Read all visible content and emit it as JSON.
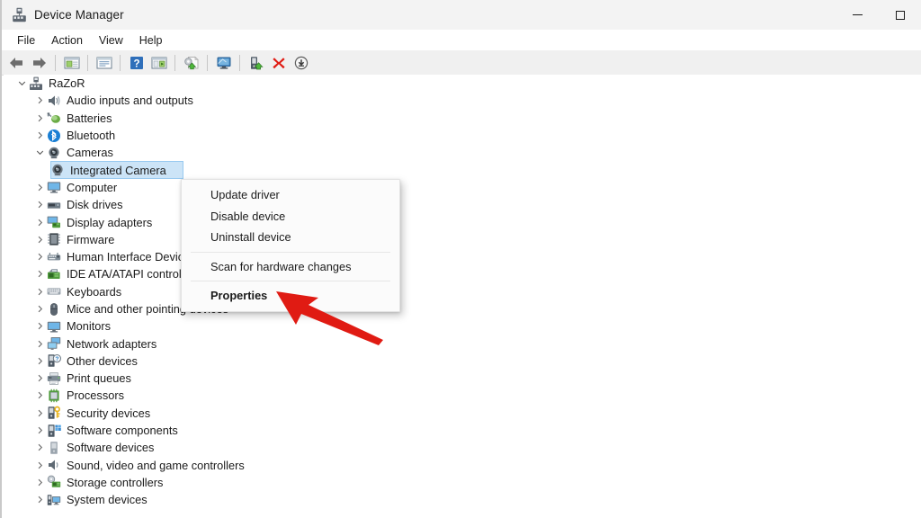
{
  "window": {
    "title": "Device Manager",
    "icon": "device-manager-icon",
    "caption_buttons": [
      {
        "name": "minimize",
        "glyph": "minimize-icon"
      },
      {
        "name": "maximize",
        "glyph": "maximize-icon"
      }
    ]
  },
  "menubar": {
    "items": [
      {
        "label": "File"
      },
      {
        "label": "Action"
      },
      {
        "label": "View"
      },
      {
        "label": "Help"
      }
    ]
  },
  "toolbar": {
    "buttons": [
      {
        "name": "back-button",
        "icon": "arrow-left-icon"
      },
      {
        "name": "forward-button",
        "icon": "arrow-right-icon"
      },
      {
        "name": "separator-1",
        "icon": "separator"
      },
      {
        "name": "show-hide-console-tree-button",
        "icon": "console-tree-icon"
      },
      {
        "name": "separator-2",
        "icon": "separator"
      },
      {
        "name": "properties-button",
        "icon": "properties-window-icon"
      },
      {
        "name": "separator-3",
        "icon": "separator"
      },
      {
        "name": "help-button",
        "icon": "help-question-icon"
      },
      {
        "name": "show-hide-action-pane-button",
        "icon": "action-pane-icon"
      },
      {
        "name": "separator-4",
        "icon": "separator"
      },
      {
        "name": "update-driver-button",
        "icon": "update-driver-icon"
      },
      {
        "name": "separator-5",
        "icon": "separator"
      },
      {
        "name": "scan-hardware-changes-button",
        "icon": "scan-monitor-icon"
      },
      {
        "name": "separator-6",
        "icon": "separator"
      },
      {
        "name": "disable-device-button",
        "icon": "disable-device-icon"
      },
      {
        "name": "uninstall-device-button",
        "icon": "red-x-icon"
      },
      {
        "name": "download-button",
        "icon": "download-circle-icon"
      }
    ]
  },
  "tree": {
    "root": {
      "label": "RaZoR",
      "icon": "computer-node-icon",
      "expanded": true
    },
    "items": [
      {
        "label": "Audio inputs and outputs",
        "icon": "speaker-icon",
        "expanded": false,
        "depth": 1
      },
      {
        "label": "Batteries",
        "icon": "battery-icon",
        "expanded": false,
        "depth": 1
      },
      {
        "label": "Bluetooth",
        "icon": "bluetooth-icon",
        "expanded": false,
        "depth": 1
      },
      {
        "label": "Cameras",
        "icon": "camera-icon",
        "expanded": true,
        "depth": 1
      },
      {
        "label": "Integrated Camera",
        "icon": "camera-icon",
        "expanded": null,
        "depth": 2,
        "selected": true
      },
      {
        "label": "Computer",
        "icon": "monitor-icon",
        "expanded": false,
        "depth": 1
      },
      {
        "label": "Disk drives",
        "icon": "disk-drive-icon",
        "expanded": false,
        "depth": 1
      },
      {
        "label": "Display adapters",
        "icon": "display-adapter-icon",
        "expanded": false,
        "depth": 1
      },
      {
        "label": "Firmware",
        "icon": "firmware-chip-icon",
        "expanded": false,
        "depth": 1
      },
      {
        "label": "Human Interface Devices",
        "icon": "hid-icon",
        "expanded": false,
        "depth": 1
      },
      {
        "label": "IDE ATA/ATAPI controllers",
        "icon": "ide-controller-icon",
        "expanded": false,
        "depth": 1
      },
      {
        "label": "Keyboards",
        "icon": "keyboard-icon",
        "expanded": false,
        "depth": 1
      },
      {
        "label": "Mice and other pointing devices",
        "icon": "mouse-icon",
        "expanded": false,
        "depth": 1
      },
      {
        "label": "Monitors",
        "icon": "monitor-icon",
        "expanded": false,
        "depth": 1
      },
      {
        "label": "Network adapters",
        "icon": "network-adapter-icon",
        "expanded": false,
        "depth": 1
      },
      {
        "label": "Other devices",
        "icon": "other-device-icon",
        "expanded": false,
        "depth": 1
      },
      {
        "label": "Print queues",
        "icon": "printer-icon",
        "expanded": false,
        "depth": 1
      },
      {
        "label": "Processors",
        "icon": "processor-icon",
        "expanded": false,
        "depth": 1
      },
      {
        "label": "Security devices",
        "icon": "security-device-icon",
        "expanded": false,
        "depth": 1
      },
      {
        "label": "Software components",
        "icon": "software-component-icon",
        "expanded": false,
        "depth": 1
      },
      {
        "label": "Software devices",
        "icon": "software-device-icon",
        "expanded": false,
        "depth": 1
      },
      {
        "label": "Sound, video and game controllers",
        "icon": "sound-controller-icon",
        "expanded": false,
        "depth": 1
      },
      {
        "label": "Storage controllers",
        "icon": "storage-controller-icon",
        "expanded": false,
        "depth": 1
      },
      {
        "label": "System devices",
        "icon": "system-device-icon",
        "expanded": false,
        "depth": 1
      }
    ]
  },
  "context_menu": {
    "target": "Integrated Camera",
    "items": [
      {
        "type": "item",
        "label": "Update driver",
        "bold": false
      },
      {
        "type": "item",
        "label": "Disable device",
        "bold": false
      },
      {
        "type": "item",
        "label": "Uninstall device",
        "bold": false
      },
      {
        "type": "separator"
      },
      {
        "type": "item",
        "label": "Scan for hardware changes",
        "bold": false
      },
      {
        "type": "separator"
      },
      {
        "type": "item",
        "label": "Properties",
        "bold": true
      }
    ]
  },
  "annotation": {
    "arrow_color": "#e01b13",
    "points_to": "Properties"
  },
  "colors": {
    "selection_fill": "#cce4f7",
    "selection_border": "#99caf0",
    "titlebar_bg": "#f3f3f3",
    "toolbar_bg": "#f0f0f0",
    "menu_bg": "#fbfbfb",
    "text": "#1b1b1b",
    "accent_red": "#e01b13"
  }
}
